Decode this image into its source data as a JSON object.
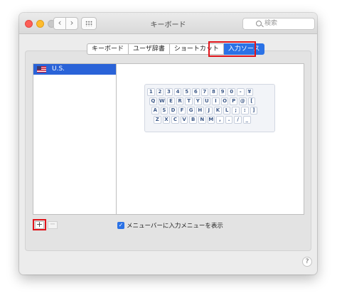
{
  "window": {
    "title": "キーボード"
  },
  "toolbar": {
    "back_icon": "chevron-left-icon",
    "forward_icon": "chevron-right-icon",
    "grid_icon": "grid-icon",
    "search_placeholder": "検索"
  },
  "tabs": [
    {
      "label": "キーボード",
      "active": false
    },
    {
      "label": "ユーザ辞書",
      "active": false
    },
    {
      "label": "ショートカット",
      "active": false
    },
    {
      "label": "入力ソース",
      "active": true
    }
  ],
  "input_sources": [
    {
      "label": "U.S.",
      "icon": "us-flag-icon",
      "selected": true
    }
  ],
  "keyboard_preview": {
    "rows": [
      [
        "1",
        "2",
        "3",
        "4",
        "5",
        "6",
        "7",
        "8",
        "9",
        "0",
        "-",
        "¥"
      ],
      [
        "Q",
        "W",
        "E",
        "R",
        "T",
        "Y",
        "U",
        "I",
        "O",
        "P",
        "@",
        "["
      ],
      [
        "A",
        "S",
        "D",
        "F",
        "G",
        "H",
        "J",
        "K",
        "L",
        ";",
        ":",
        "]"
      ],
      [
        "Z",
        "X",
        "C",
        "V",
        "B",
        "N",
        "M",
        ",",
        ".",
        "/",
        "_"
      ]
    ]
  },
  "controls": {
    "add_label": "+",
    "remove_label": "−",
    "menu_checkbox_label": "メニューバーに入力メニューを表示",
    "menu_checkbox_checked": true,
    "help_label": "?"
  },
  "colors": {
    "accent": "#2b72e6",
    "highlight_red": "#e0141a"
  }
}
